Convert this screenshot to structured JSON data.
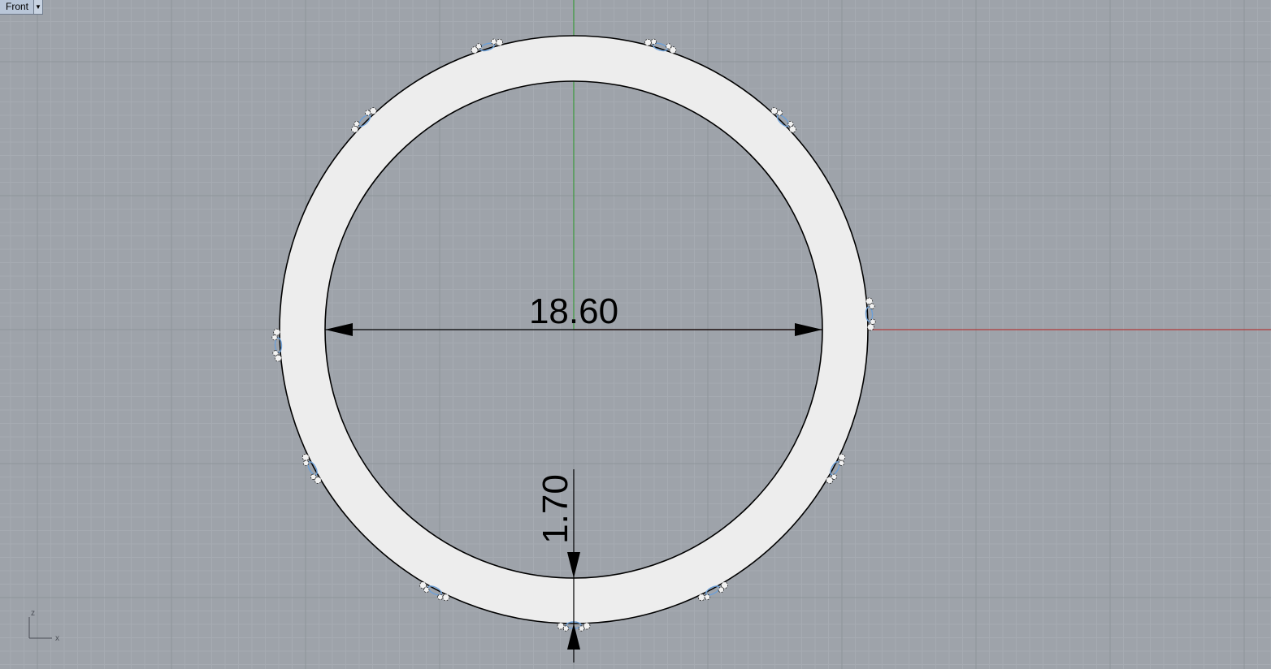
{
  "viewport": {
    "name": "Front",
    "menu_icon": "caret-down-icon"
  },
  "colors": {
    "background": "#9ea3aa",
    "grid_minor": "#a6abb2",
    "grid_major": "#8f949b",
    "x_axis": "#b03a3a",
    "z_axis": "#3c9a3c",
    "ring_fill": "#ededed",
    "outline": "#000000",
    "control_point": "#6da0d8"
  },
  "dimensions": {
    "diameter": "18.60",
    "thickness": "1.70"
  },
  "axis_widget": {
    "vertical": "z",
    "horizontal": "x"
  }
}
